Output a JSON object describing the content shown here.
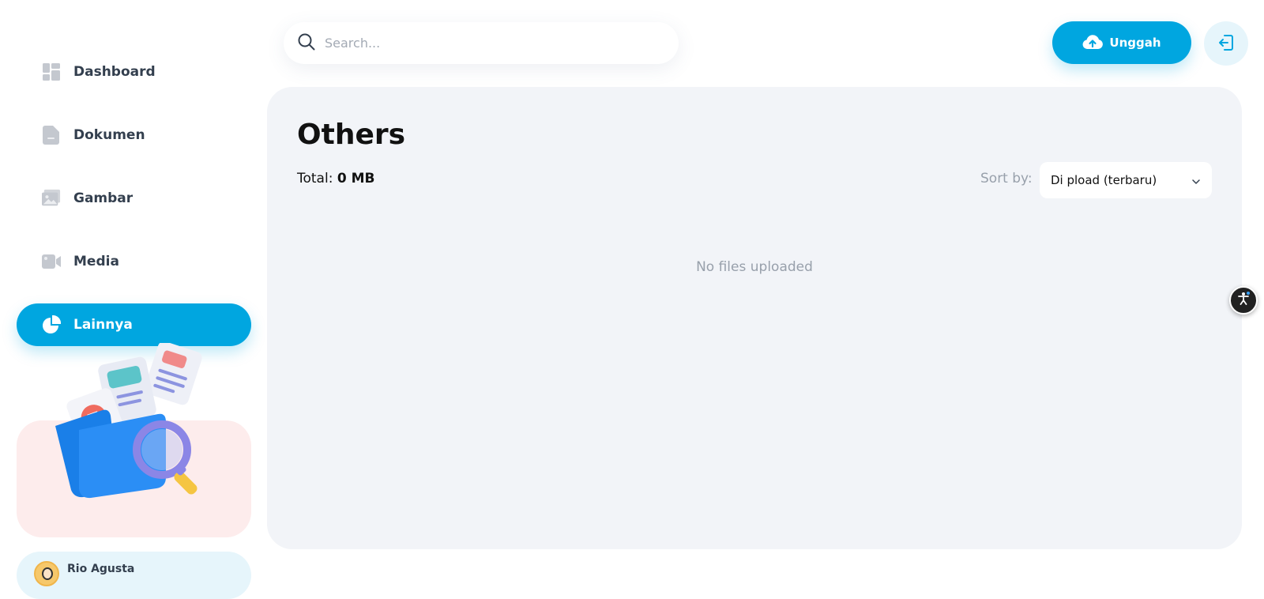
{
  "sidebar": {
    "items": [
      {
        "label": "Dashboard",
        "icon": "dashboard-icon",
        "active": false
      },
      {
        "label": "Dokumen",
        "icon": "document-icon",
        "active": false
      },
      {
        "label": "Gambar",
        "icon": "image-icon",
        "active": false
      },
      {
        "label": "Media",
        "icon": "video-icon",
        "active": false
      },
      {
        "label": "Lainnya",
        "icon": "pie-chart-icon",
        "active": true
      }
    ],
    "user": {
      "name": "Rio Agusta"
    }
  },
  "header": {
    "search_placeholder": "Search...",
    "upload_label": "Unggah"
  },
  "main": {
    "title": "Others",
    "total_label": "Total:",
    "total_value": "0 MB",
    "sort_label": "Sort by:",
    "sort_value": "Di pload (terbaru)",
    "empty_message": "No files uploaded"
  },
  "colors": {
    "accent": "#00a6e0",
    "panel_bg": "#f2f4f8",
    "promo_bg": "#fdecec",
    "muted_text": "#98a0ab"
  }
}
